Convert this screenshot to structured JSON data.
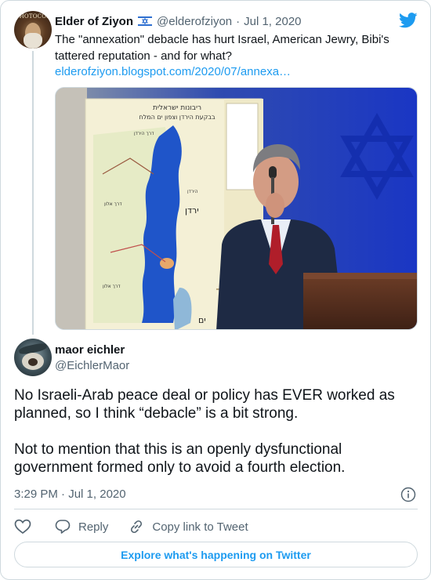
{
  "parent": {
    "avatar_text": "CHOTOCOD",
    "name": "Elder of Ziyon",
    "handle": "@elderofziyon",
    "separator": "·",
    "date": "Jul 1, 2020",
    "text": "The \"annexation\" debacle has hurt Israel, American Jewry, Bibi's tattered reputation - and for what?",
    "link": "elderofziyon.blogspot.com/2020/07/annexa…",
    "flag_icon": "israel-flag-icon"
  },
  "media": {
    "map_title_line1": "ריבונות ישראלית",
    "map_title_line2": "בבקעת הירדן וצפון ים המלח",
    "map_label_jordan": "ירדן",
    "map_label_yam": "ים",
    "map_label_a": "הירדן",
    "map_label_b": "דרך אלון",
    "map_label_c": "דרך אלון",
    "map_label_d": "דרך הירדן"
  },
  "reply": {
    "name": "maor eichler",
    "handle": "@EichlerMaor",
    "text": "No Israeli-Arab peace deal or policy has EVER worked as planned, so I think “debacle” is a bit strong.\n\nNot to mention that this is an openly dysfunctional government formed only to avoid a fourth election.",
    "time": "3:29 PM",
    "separator": "·",
    "date": "Jul 1, 2020"
  },
  "actions": {
    "reply_label": "Reply",
    "copy_label": "Copy link to Tweet"
  },
  "explore_label": "Explore what's happening on Twitter",
  "colors": {
    "accent": "#1d9bf0",
    "text": "#0f1419",
    "muted": "#536471",
    "border": "#cfd9de"
  }
}
